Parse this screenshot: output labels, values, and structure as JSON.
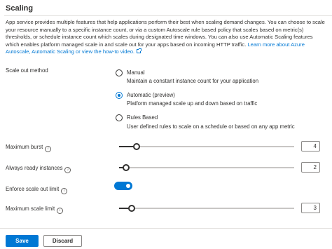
{
  "section": {
    "title": "Scaling"
  },
  "description": {
    "text": "App service provides multiple features that help applications perform their best when scaling demand changes. You can choose to scale your resource manually to a specific instance count, or via a custom Autoscale rule based policy that scales based on metric(s) thresholds, or schedule instance count which scales during designated time windows. You can also use Automatic Scaling features which enables platform managed scale in and scale out for your apps based on incoming HTTP traffic.",
    "link": "Learn more about Azure Autoscale, Automatic Scaling or view the how-to video."
  },
  "scale_out": {
    "label": "Scale out method",
    "selected": "automatic",
    "options": [
      {
        "key": "manual",
        "title": "Manual",
        "subtitle": "Maintain a constant instance count for your application"
      },
      {
        "key": "automatic",
        "title": "Automatic (preview)",
        "subtitle": "Platform managed scale up and down based on traffic"
      },
      {
        "key": "rules",
        "title": "Rules Based",
        "subtitle": "User defined rules to scale on a schedule or based on any app metric"
      }
    ]
  },
  "maximum_burst": {
    "label": "Maximum burst",
    "value": "4",
    "slider_fraction": 0.1
  },
  "always_ready": {
    "label": "Always ready instances",
    "value": "2",
    "slider_fraction": 0.04
  },
  "enforce_limit": {
    "label": "Enforce scale out limit",
    "enabled": true
  },
  "maximum_scale_limit": {
    "label": "Maximum scale limit",
    "value": "3",
    "slider_fraction": 0.07
  },
  "buttons": {
    "save": "Save",
    "discard": "Discard"
  },
  "colors": {
    "accent": "#0078d4",
    "text": "#323130",
    "divider": "#e1dfdd"
  },
  "icons": [
    "info-icon",
    "external-link-icon"
  ]
}
